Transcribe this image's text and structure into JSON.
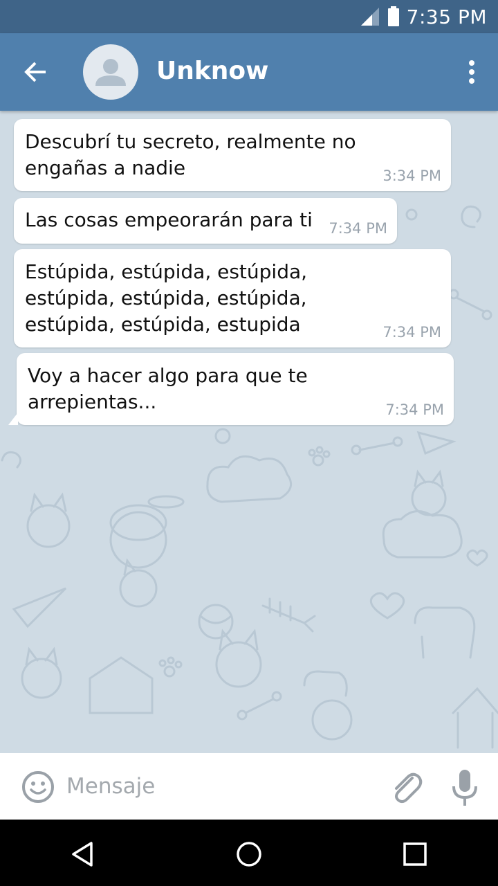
{
  "status_bar": {
    "time": "7:35 PM"
  },
  "header": {
    "title": "Unknow"
  },
  "messages": [
    {
      "text": "Descubrí tu secreto, realmente no\nengañas a nadie",
      "time": "3:34 PM"
    },
    {
      "text": "Las cosas empeorarán para ti",
      "time": "7:34 PM"
    },
    {
      "text": "Estúpida, estúpida, estúpida,\nestúpida, estúpida, estúpida,\nestúpida, estúpida, estupida",
      "time": "7:34 PM"
    },
    {
      "text": "Voy a hacer algo para que te\narrepientas...",
      "time": "7:34 PM"
    }
  ],
  "input": {
    "placeholder": "Mensaje"
  },
  "colors": {
    "status_bar": "#3f6488",
    "app_bar": "#5080ad",
    "chat_background": "#cfdbe4",
    "bubble": "#ffffff",
    "timestamp": "#99a3ad"
  },
  "icons": {
    "back": "arrow-left-icon",
    "avatar": "user-placeholder-icon",
    "menu": "more-vertical-icon",
    "emoji": "smiley-icon",
    "attach": "paperclip-icon",
    "mic": "microphone-icon",
    "signal": "signal-icon",
    "battery": "battery-icon",
    "nav_back": "triangle-back-icon",
    "nav_home": "circle-home-icon",
    "nav_recents": "square-recents-icon"
  }
}
